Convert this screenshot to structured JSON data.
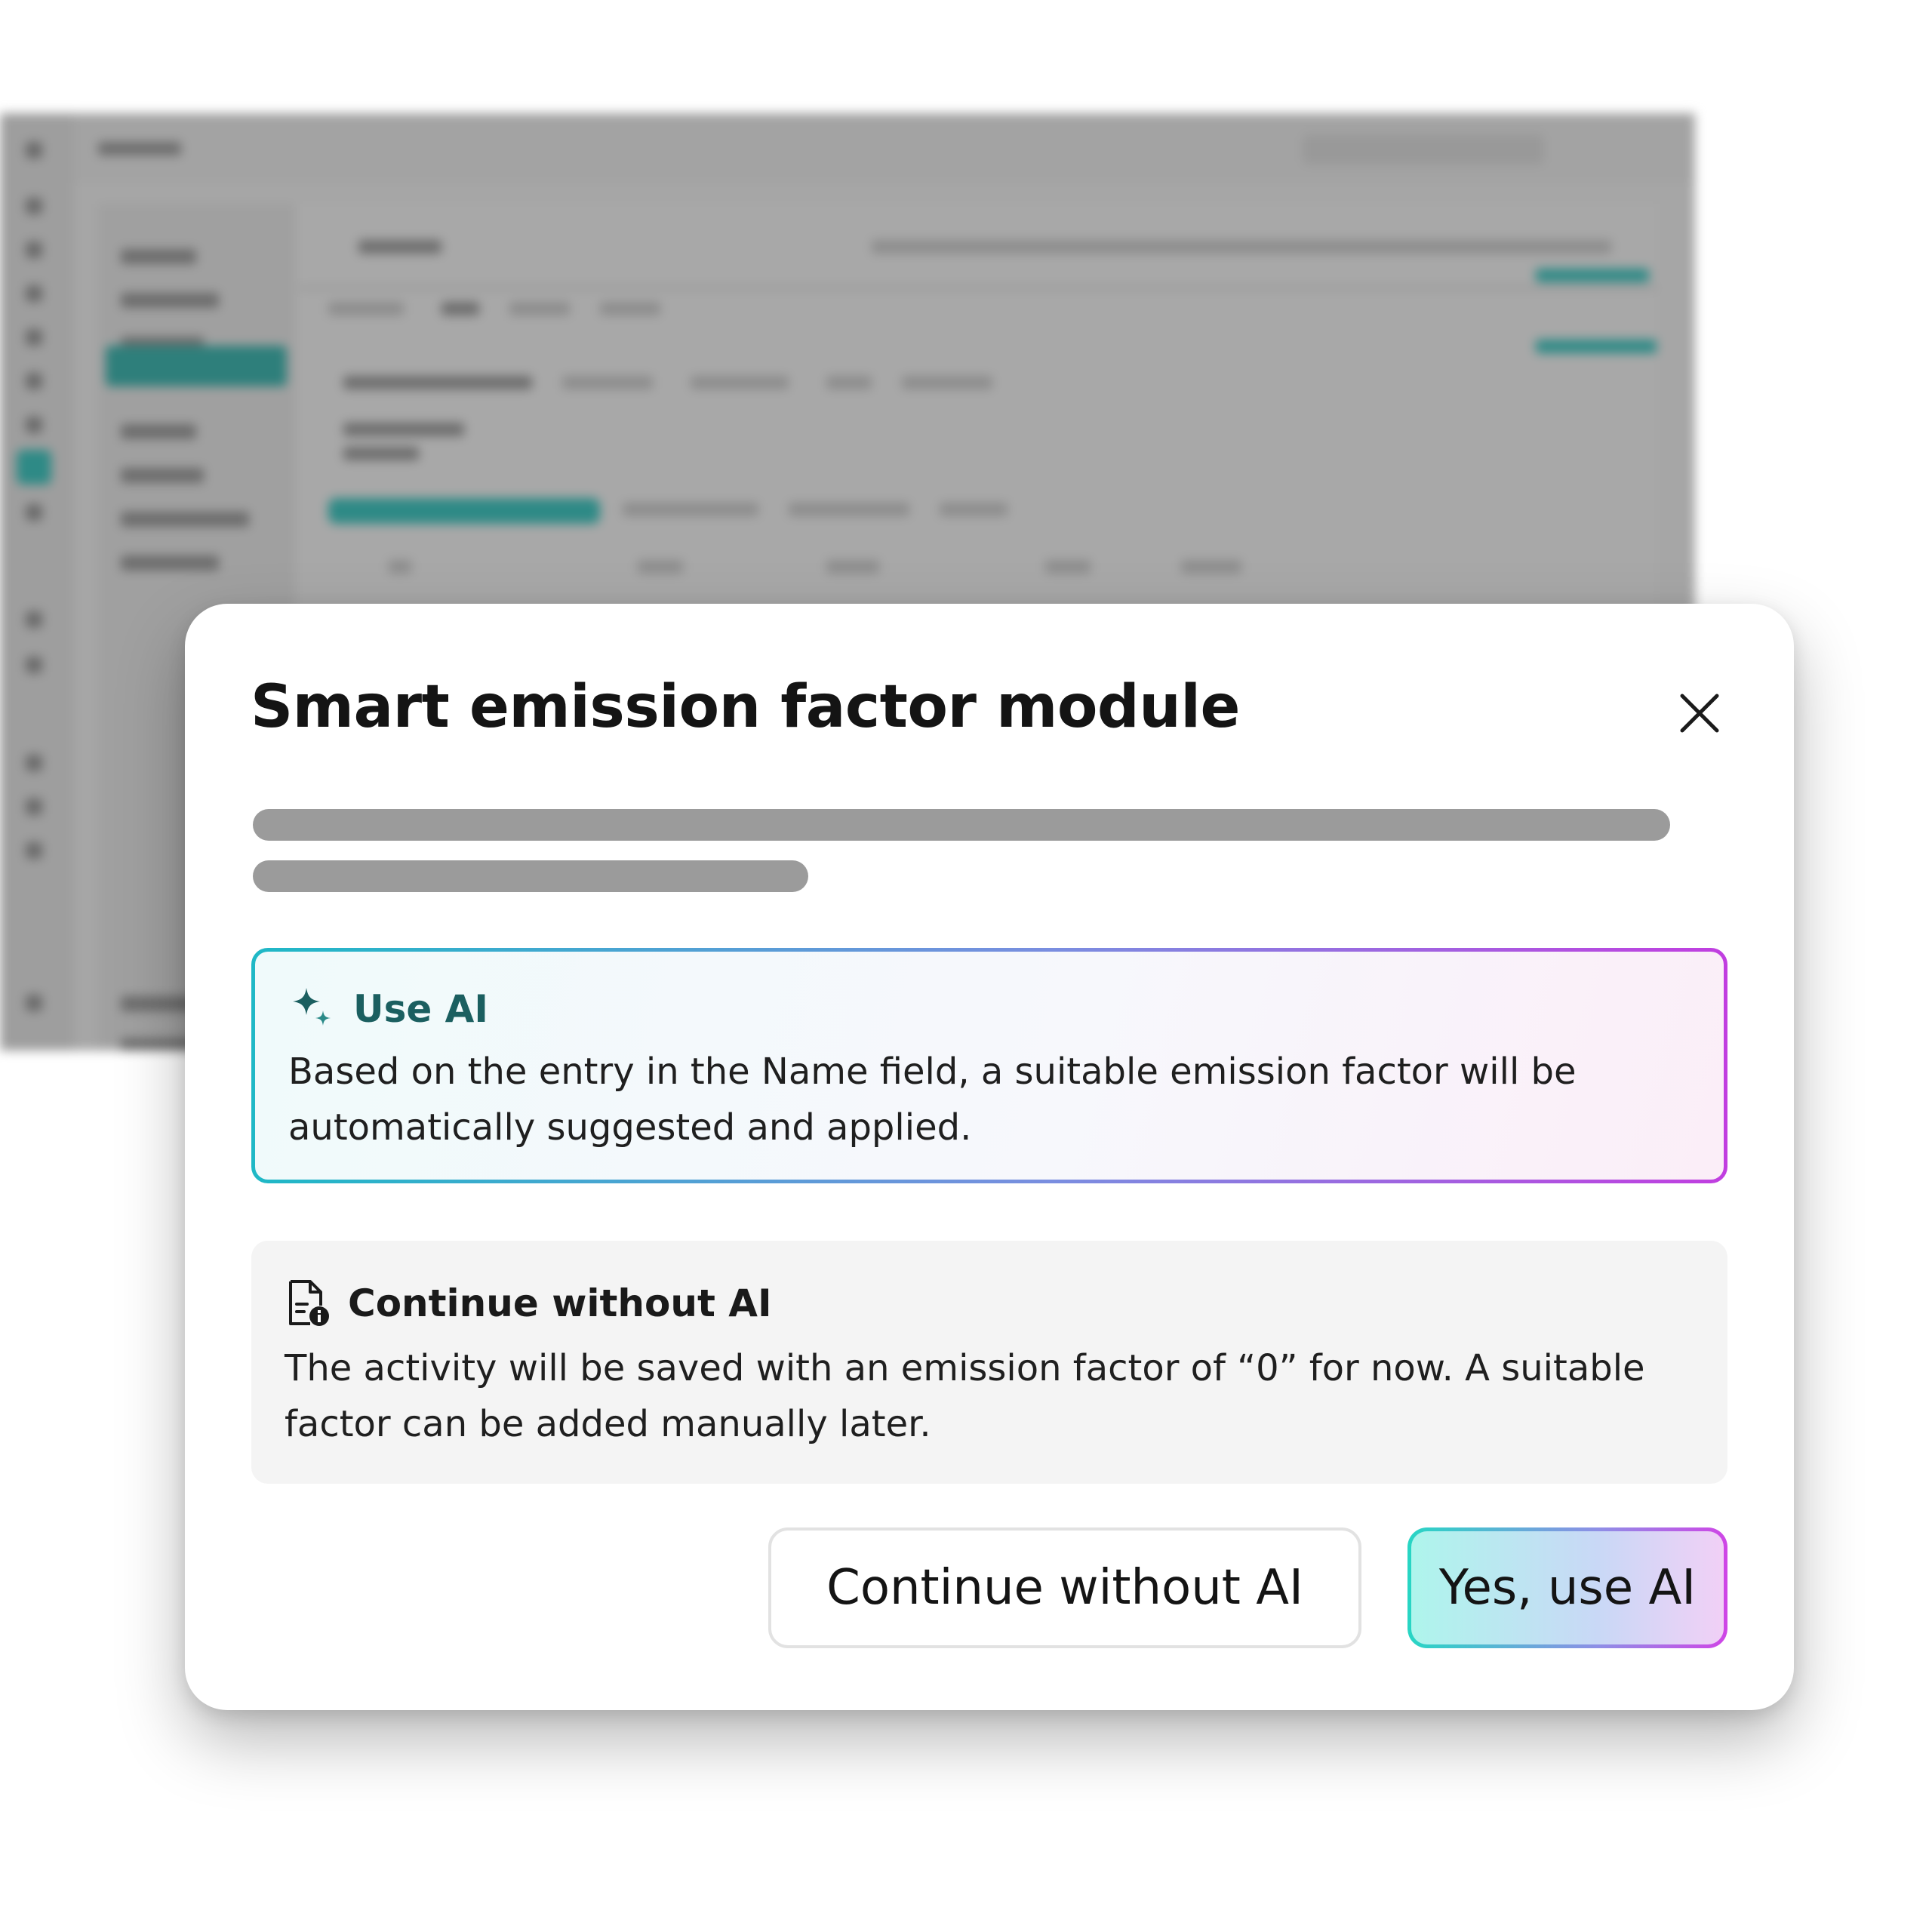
{
  "modal": {
    "title": "Smart emission factor module",
    "close_icon": "close-icon"
  },
  "options": {
    "use_ai": {
      "icon": "sparkles-icon",
      "title": "Use AI",
      "description": "Based on the entry in the Name field, a suitable emission factor will be automatically suggested and applied."
    },
    "no_ai": {
      "icon": "document-info-icon",
      "title": "Continue without AI",
      "description": "The activity will be saved with an emission factor of “0” for now. A suitable factor can be added manually later."
    }
  },
  "buttons": {
    "secondary_label": "Continue without AI",
    "primary_label": "Yes, use AI"
  },
  "colors": {
    "ai_accent": "#1b5f60",
    "gradient_start": "#1fb8c6",
    "gradient_end": "#c13ee0"
  }
}
